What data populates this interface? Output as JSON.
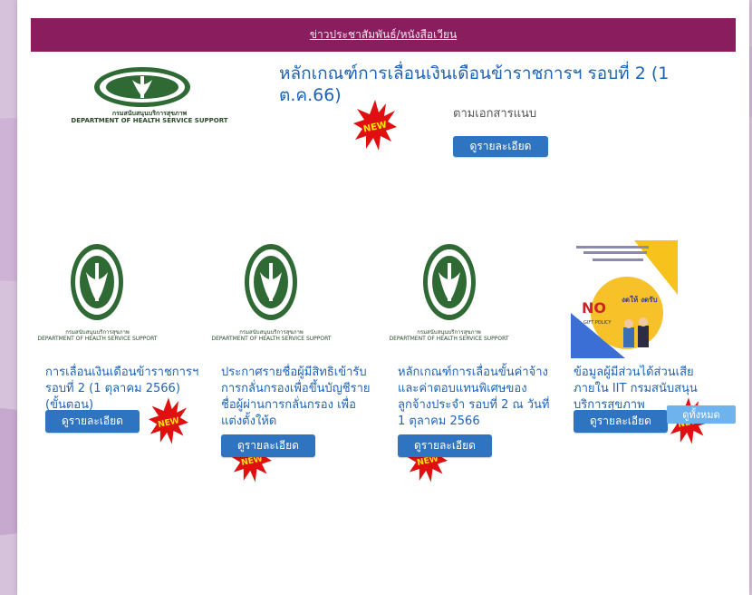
{
  "header": {
    "link_label": "ข่าวประชาสัมพันธ์/หนังสือเวียน"
  },
  "featured": {
    "title": "หลักเกณฑ์การเลื่อนเงินเดือนข้าราชการฯ รอบที่ 2 (1 ต.ค.66)",
    "subtitle": "ตามเอกสารแนบ",
    "button_label": "ดูรายละเอียด",
    "logo_caption_th": "กรมสนับสนุนบริการสุขภาพ",
    "logo_caption_en": "DEPARTMENT OF HEALTH SERVICE SUPPORT",
    "badge_label": "NEW"
  },
  "cards": [
    {
      "title": "การเลื่อนเงินเดือนข้าราชการฯรอบที่ 2 (1 ตุลาคม 2566) (ขั้นตอน)",
      "button_label": "ดูรายละเอียด",
      "logo_caption_th": "กรมสนับสนุนบริการสุขภาพ",
      "logo_caption_en": "DEPARTMENT OF HEALTH SERVICE SUPPORT",
      "badge_label": "NEW"
    },
    {
      "title": "ประกาศรายชื่อผู้มีสิทธิเข้ารับการกลั่นกรองเพื่อขึ้นบัญชีรายชื่อผู้ผ่านการกลั่นกรอง เพื่อแต่งตั้งให้ด",
      "button_label": "ดูรายละเอียด",
      "logo_caption_th": "กรมสนับสนุนบริการสุขภาพ",
      "logo_caption_en": "DEPARTMENT OF HEALTH SERVICE SUPPORT",
      "badge_label": "NEW"
    },
    {
      "title": "หลักเกณฑ์การเลื่อนขั้นค่าจ้างและค่าตอบแทนพิเศษของลูกจ้างประจำ รอบที่ 2 ณ วันที่ 1 ตุลาคม 2566",
      "button_label": "ดูรายละเอียด",
      "logo_caption_th": "กรมสนับสนุนบริการสุขภาพ",
      "logo_caption_en": "DEPARTMENT OF HEALTH SERVICE SUPPORT",
      "badge_label": "NEW"
    },
    {
      "title": "ข้อมูลผู้มีส่วนได้ส่วนเสียภายใน IIT กรมสนับสนุนบริการสุขภาพ",
      "button_label": "ดูรายละเอียด",
      "badge_label": "NEW",
      "poster": {
        "no_label": "NO",
        "gift_label": "GIFT POLICY",
        "headline": "งดให้ งดรับ"
      }
    }
  ],
  "view_all_label": "ดูทั้งหมด",
  "colors": {
    "header_bar": "#8a1d5e",
    "link_blue": "#1d63b8",
    "button_blue": "#2f74c0",
    "view_all": "#6eb2ee",
    "seal_green": "#2f6a35",
    "badge_red": "#e01010",
    "badge_yellow": "#ffe600"
  }
}
